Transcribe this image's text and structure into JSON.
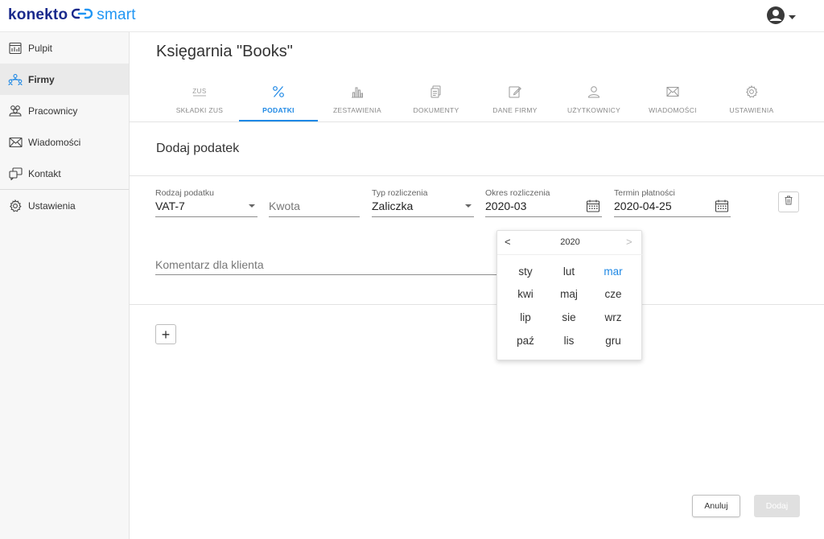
{
  "app": {
    "logo_left": "konekto",
    "logo_right": "smart",
    "brand_color": "#1a2a8c",
    "accent_color": "#1e88e5"
  },
  "user_menu": {
    "icon": "user-circle-icon"
  },
  "sidebar": {
    "items": [
      {
        "label": "Pulpit",
        "icon": "dashboard-icon",
        "active": false
      },
      {
        "label": "Firmy",
        "icon": "companies-icon",
        "active": true
      },
      {
        "label": "Pracownicy",
        "icon": "employees-icon",
        "active": false
      },
      {
        "label": "Wiadomości",
        "icon": "envelope-icon",
        "active": false
      },
      {
        "label": "Kontakt",
        "icon": "contact-icon",
        "active": false
      },
      {
        "label": "Ustawienia",
        "icon": "gear-icon",
        "active": false
      }
    ]
  },
  "page": {
    "company_title": "Księgarnia \"Books\"",
    "section_title": "Dodaj podatek"
  },
  "tabs": [
    {
      "label": "SKŁADKI ZUS",
      "icon": "zus-icon",
      "active": false
    },
    {
      "label": "PODATKI",
      "icon": "percent-icon",
      "active": true
    },
    {
      "label": "ZESTAWIENIA",
      "icon": "bar-chart-icon",
      "active": false
    },
    {
      "label": "DOKUMENTY",
      "icon": "documents-icon",
      "active": false
    },
    {
      "label": "DANE FIRMY",
      "icon": "edit-icon",
      "active": false
    },
    {
      "label": "UŻYTKOWNICY",
      "icon": "user-icon",
      "active": false
    },
    {
      "label": "WIADOMOŚCI",
      "icon": "envelope-icon",
      "active": false
    },
    {
      "label": "USTAWIENIA",
      "icon": "gear-icon",
      "active": false
    }
  ],
  "form": {
    "tax_type": {
      "label": "Rodzaj podatku",
      "value": "VAT-7"
    },
    "amount": {
      "placeholder": "Kwota"
    },
    "settlement_type": {
      "label": "Typ rozliczenia",
      "value": "Zaliczka"
    },
    "settlement_period": {
      "label": "Okres rozliczenia",
      "value": "2020-03"
    },
    "payment_due": {
      "label": "Termin płatności",
      "value": "2020-04-25"
    },
    "comment": {
      "placeholder": "Komentarz dla klienta"
    }
  },
  "month_picker": {
    "year": "2020",
    "prev": "<",
    "next": ">",
    "selected": "mar",
    "months": [
      "sty",
      "lut",
      "mar",
      "kwi",
      "maj",
      "cze",
      "lip",
      "sie",
      "wrz",
      "paź",
      "lis",
      "gru"
    ]
  },
  "actions": {
    "add_symbol": "+",
    "cancel_label": "Anuluj",
    "submit_label": "Dodaj"
  }
}
